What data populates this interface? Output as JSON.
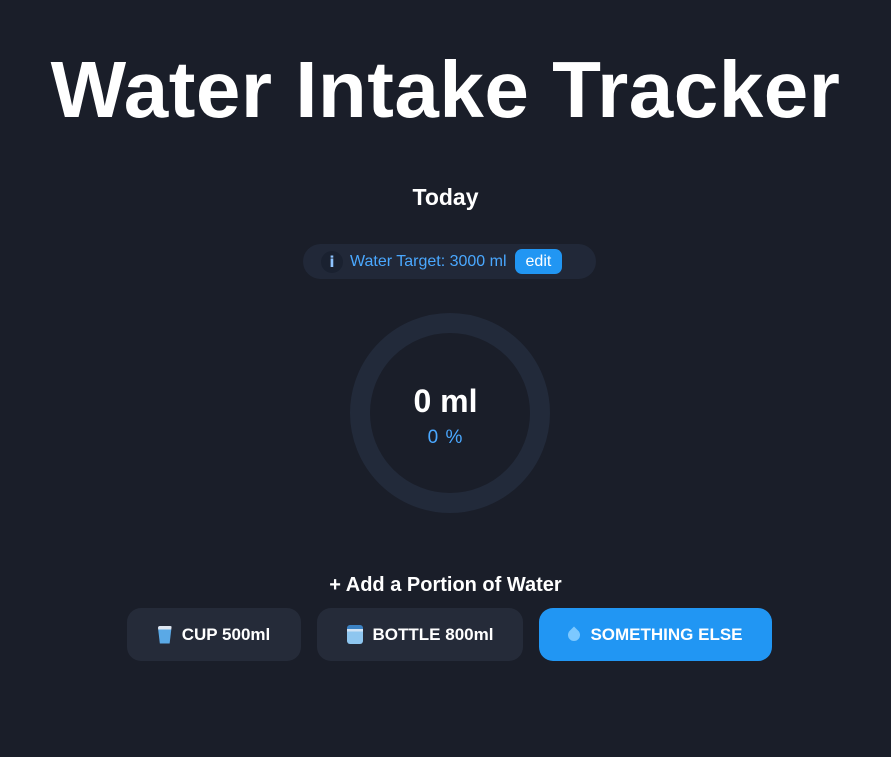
{
  "header": {
    "title": "Water Intake Tracker",
    "day": "Today"
  },
  "target": {
    "info_symbol": "i",
    "text": "Water Target: 3000 ml",
    "edit_label": "edit"
  },
  "progress": {
    "amount": "0 ml",
    "percent": "0 %",
    "fraction": 0
  },
  "portions": {
    "heading": "+ Add a Portion of Water",
    "buttons": [
      {
        "icon": "cup-icon",
        "label": "CUP 500ml"
      },
      {
        "icon": "bottle-icon",
        "label": "BOTTLE 800ml"
      },
      {
        "icon": "droplet-icon",
        "label": "SOMETHING ELSE"
      }
    ]
  },
  "colors": {
    "background": "#1a1e29",
    "accent": "#2196f3",
    "accent_text": "#4aa8ff",
    "button_bg": "#252b39",
    "ring_track": "#222a3a"
  }
}
